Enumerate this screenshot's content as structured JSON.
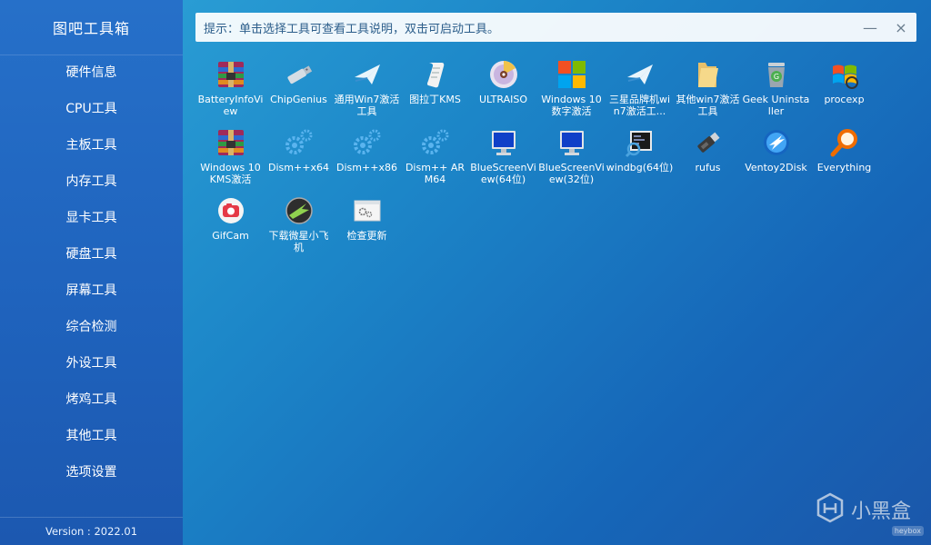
{
  "app": {
    "title": "图吧工具箱",
    "version": "Version : 2022.01"
  },
  "sidebar": {
    "items": [
      {
        "label": "硬件信息"
      },
      {
        "label": "CPU工具"
      },
      {
        "label": "主板工具"
      },
      {
        "label": "内存工具"
      },
      {
        "label": "显卡工具"
      },
      {
        "label": "硬盘工具"
      },
      {
        "label": "屏幕工具"
      },
      {
        "label": "综合检测"
      },
      {
        "label": "外设工具"
      },
      {
        "label": "烤鸡工具"
      },
      {
        "label": "其他工具"
      },
      {
        "label": "选项设置"
      }
    ]
  },
  "hint": {
    "text": "提示：单击选择工具可查看工具说明，双击可启动工具。",
    "minimize": "—",
    "close": "×"
  },
  "tools": [
    {
      "label": "BatteryInfoView",
      "icon": "winrar-archive-icon"
    },
    {
      "label": "ChipGenius",
      "icon": "usb-drive-icon"
    },
    {
      "label": "通用Win7激活工具",
      "icon": "paper-plane-icon"
    },
    {
      "label": "图拉丁KMS",
      "icon": "scroll-icon"
    },
    {
      "label": "ULTRAISO",
      "icon": "disc-icon"
    },
    {
      "label": "Windows 10 数字激活",
      "icon": "windows-logo-icon"
    },
    {
      "label": "三星品牌机win7激活工...",
      "icon": "paper-plane-icon"
    },
    {
      "label": "其他win7激活工具",
      "icon": "folder-icon"
    },
    {
      "label": "Geek Uninstaller",
      "icon": "trash-can-icon"
    },
    {
      "label": "procexp",
      "icon": "windows-flag-icon"
    },
    {
      "label": "Windows 10 KMS激活",
      "icon": "winrar-archive-icon"
    },
    {
      "label": "Dism++x64",
      "icon": "gears-icon"
    },
    {
      "label": "Dism++x86",
      "icon": "gears-icon"
    },
    {
      "label": "Dism++ ARM64",
      "icon": "gears-icon"
    },
    {
      "label": "BlueScreenView(64位)",
      "icon": "bluescreen-monitor-icon"
    },
    {
      "label": "BlueScreenView(32位)",
      "icon": "bluescreen-monitor-icon"
    },
    {
      "label": "windbg(64位)",
      "icon": "debugger-icon"
    },
    {
      "label": "rufus",
      "icon": "usb-stick-icon"
    },
    {
      "label": "Ventoy2Disk",
      "icon": "ventoy-orb-icon"
    },
    {
      "label": "Everything",
      "icon": "magnifier-icon"
    },
    {
      "label": "GifCam",
      "icon": "camera-icon"
    },
    {
      "label": "下载微星小飞机",
      "icon": "afterburner-icon"
    },
    {
      "label": "检查更新",
      "icon": "update-window-icon"
    }
  ],
  "brand": {
    "name": "小黑盒",
    "tag": "heybox"
  },
  "colors": {
    "sidebar": "#2268c2",
    "background": "#1c86c8",
    "hint_text": "#2b5d8a"
  }
}
